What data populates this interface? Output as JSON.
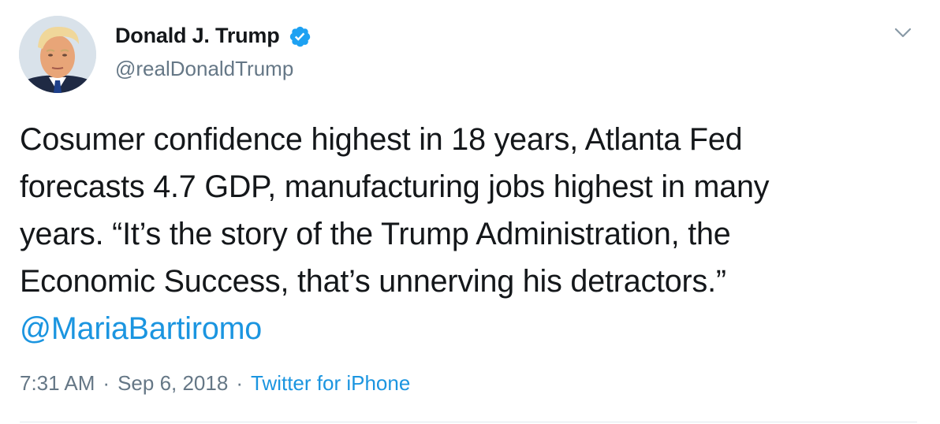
{
  "author": {
    "display_name": "Donald J. Trump",
    "handle": "@realDonaldTrump",
    "verified": true,
    "avatar_icon": "profile-photo"
  },
  "tweet": {
    "lines": [
      "Cosumer confidence highest in 18 years, Atlanta Fed",
      "forecasts 4.7 GDP, manufacturing jobs highest in many",
      "years. “It’s the story of the Trump Administration, the",
      "Economic Success, that’s unnerving his detractors.”"
    ],
    "mention": "@MariaBartiromo"
  },
  "meta": {
    "time": "7:31 AM",
    "separator": "·",
    "date": "Sep 6, 2018",
    "source": "Twitter for iPhone"
  },
  "colors": {
    "link": "#1b95e0",
    "secondary_text": "#657786",
    "verified_badge": "#1da1f2",
    "primary_text": "#14171a"
  },
  "icons": {
    "verified": "verified-badge-icon",
    "menu": "chevron-down-icon"
  }
}
